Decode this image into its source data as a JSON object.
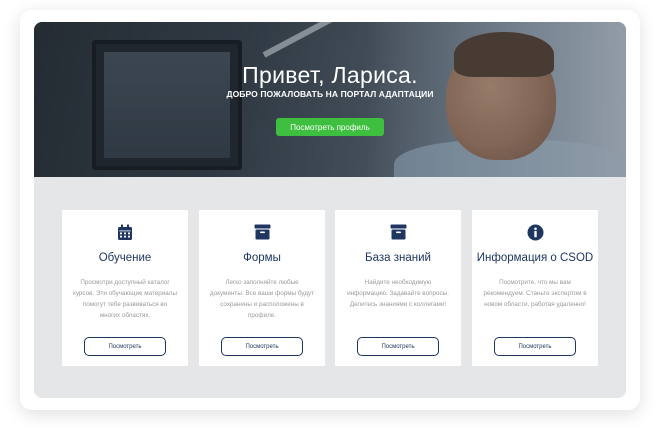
{
  "hero": {
    "title": "Привет, Лариса.",
    "subtitle": "ДОБРО ПОЖАЛОВАТЬ НА ПОРТАЛ АДАПТАЦИИ",
    "profile_button_label": "Посмотреть профиль",
    "profile_button_color": "#3fbf3f"
  },
  "cards": [
    {
      "icon": "calendar-icon",
      "title": "Обучение",
      "text": "Просмотри доступный каталог курсов. Эти обучающие материалы помогут тебе развиваться во многих областях.",
      "button_label": "Посмотреть"
    },
    {
      "icon": "archive-box-icon",
      "title": "Формы",
      "text": "Легко заполняйте любые документы. Все ваши формы будут сохранены и расположены в профиле.",
      "button_label": "Посмотреть"
    },
    {
      "icon": "archive-box-icon",
      "title": "База знаний",
      "text": "Найдите необходимую информацию. Задавайте вопросы. Делитесь знаниями с коллегами!",
      "button_label": "Посмотреть"
    },
    {
      "icon": "info-circle-icon",
      "title": "Информация о CSOD",
      "text": "Посмотрите, что мы вам рекомендуем. Станьте экспертом в новом области, работая удаленно!",
      "button_label": "Посмотреть"
    }
  ],
  "colors": {
    "accent_navy": "#1f3760",
    "section_background": "#e4e6e7"
  }
}
